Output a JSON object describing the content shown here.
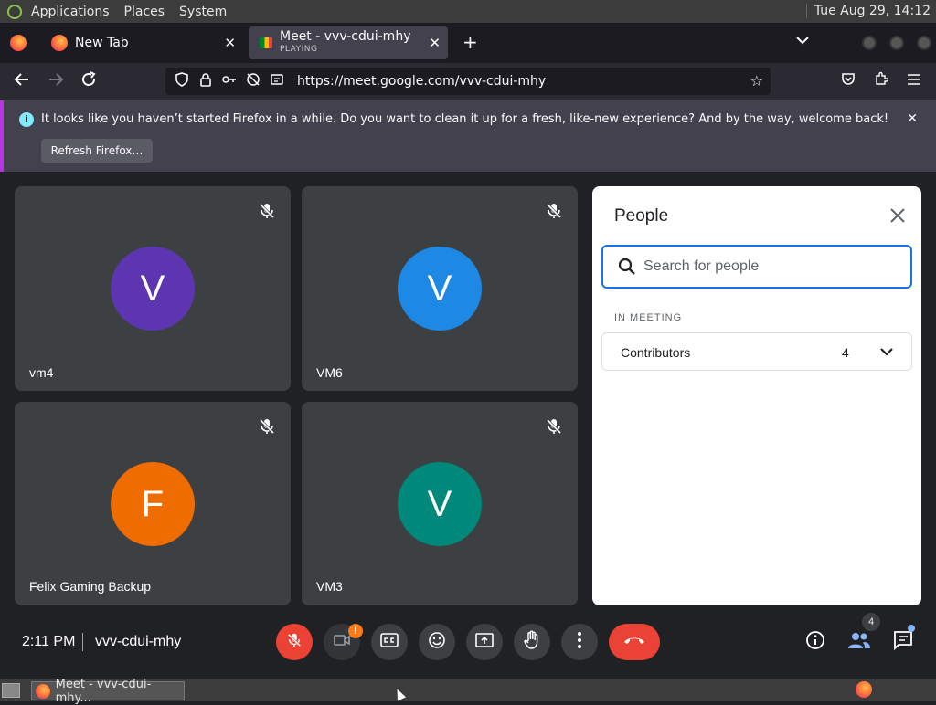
{
  "system_bar": {
    "menus": [
      "Applications",
      "Places",
      "System"
    ],
    "clock": "Tue Aug 29, 14:12"
  },
  "browser": {
    "tabs": [
      {
        "title": "New Tab",
        "subtitle": ""
      },
      {
        "title": "Meet - vvv-cdui-mhy",
        "subtitle": "PLAYING"
      }
    ],
    "url": "https://meet.google.com/vvv-cdui-mhy",
    "notification": {
      "message": "It looks like you haven’t started Firefox in a while. Do you want to clean it up for a fresh, like-new experience? And by the way, welcome back!",
      "button_label": "Refresh Firefox…"
    }
  },
  "meet": {
    "tiles": [
      {
        "name": "vm4",
        "initial": "V",
        "color": "#5e35b1"
      },
      {
        "name": "VM6",
        "initial": "V",
        "color": "#1e88e5"
      },
      {
        "name": "Felix Gaming Backup",
        "initial": "F",
        "color": "#ef6c00"
      },
      {
        "name": "VM3",
        "initial": "V",
        "color": "#00897b"
      }
    ],
    "people_panel": {
      "title": "People",
      "search_placeholder": "Search for people",
      "section_label": "IN MEETING",
      "group_label": "Contributors",
      "group_count": "4"
    },
    "bottom_bar": {
      "time": "2:11 PM",
      "meeting_code": "vvv-cdui-mhy",
      "camera_warning": "!",
      "people_count": "4"
    }
  },
  "taskbar": {
    "window_label": "Meet - vvv-cdui-mhy..."
  },
  "colors": {
    "accent_blue": "#1a73e8",
    "end_call_red": "#ea4335"
  }
}
